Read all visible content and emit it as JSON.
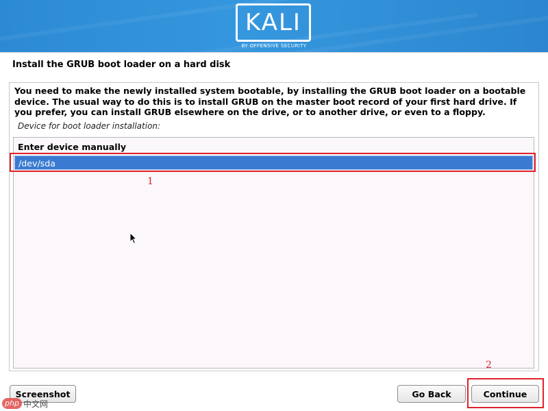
{
  "header": {
    "logo_text": "KALI",
    "logo_subtext": "BY OFFENSIVE SECURITY"
  },
  "page": {
    "title": "Install the GRUB boot loader on a hard disk",
    "description": "You need to make the newly installed system bootable, by installing the GRUB boot loader on a bootable device. The usual way to do this is to install GRUB on the master boot record of your first hard drive. If you prefer, you can install GRUB elsewhere on the drive, or to another drive, or even to a floppy.",
    "field_label": "Device for boot loader installation:"
  },
  "device_list": {
    "items": [
      {
        "label": "Enter device manually",
        "selected": false
      },
      {
        "label": "/dev/sda",
        "selected": true
      }
    ]
  },
  "annotations": {
    "marker_1": "1",
    "marker_2": "2"
  },
  "buttons": {
    "screenshot_label": "Screenshot",
    "goback_label": "Go Back",
    "continue_label": "Continue"
  },
  "watermark": {
    "logo": "php",
    "text": "中文网"
  },
  "colors": {
    "banner": "#3597de",
    "selection": "#3a7ad1",
    "annotation": "#e0212b"
  },
  "icons": {
    "cursor": "mouse-pointer-icon"
  }
}
